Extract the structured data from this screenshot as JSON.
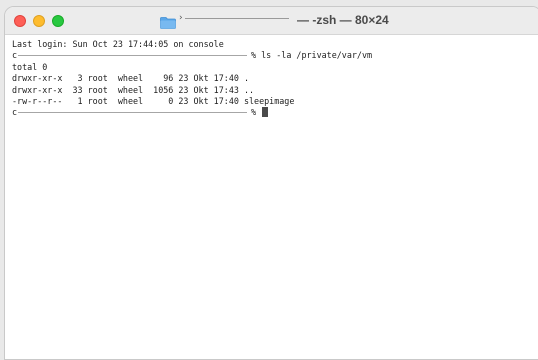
{
  "window": {
    "title": "— -zsh — 80×24"
  },
  "terminal": {
    "last_login": "Last login: Sun Oct 23 17:44:05 on console",
    "command_prompt_prefix": "c",
    "command_prompt_suffix": "% ls -la /private/var/vm",
    "total": "total 0",
    "listing": [
      "drwxr-xr-x   3 root  wheel    96 23 Okt 17:40 .",
      "drwxr-xr-x  33 root  wheel  1056 23 Okt 17:43 ..",
      "-rw-r--r--   1 root  wheel     0 23 Okt 17:40 sleepimage"
    ],
    "current_prompt_prefix": "c",
    "current_prompt_suffix": "% "
  },
  "colors": {
    "close": "#fe5f57",
    "minimize": "#febc2e",
    "zoom": "#28c840",
    "folder_icon": "#5aa6e8"
  },
  "icons": [
    "folder-icon"
  ]
}
